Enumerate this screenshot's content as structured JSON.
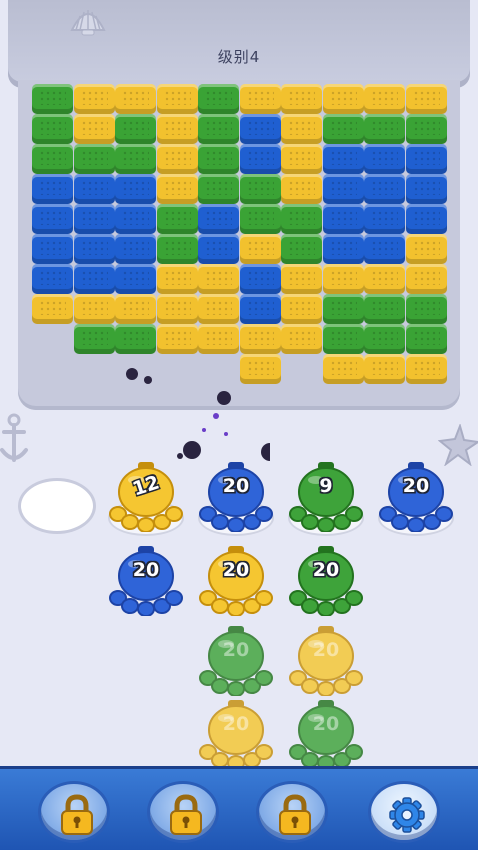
{
  "level": {
    "label": "级别4"
  },
  "colors": {
    "green": "#3aa335",
    "blue": "#1f5fd1",
    "yellow": "#f2c12e"
  },
  "board": {
    "columns": 10,
    "rows": 10,
    "grid": [
      [
        "g",
        "y",
        "y",
        "y",
        "g",
        "y",
        "y",
        "y",
        "y",
        "y"
      ],
      [
        "g",
        "y",
        "g",
        "y",
        "g",
        "b",
        "y",
        "g",
        "g",
        "g"
      ],
      [
        "g",
        "g",
        "g",
        "y",
        "g",
        "b",
        "y",
        "b",
        "b",
        "b"
      ],
      [
        "b",
        "b",
        "b",
        "y",
        "g",
        "g",
        "y",
        "b",
        "b",
        "b"
      ],
      [
        "b",
        "b",
        "b",
        "g",
        "b",
        "g",
        "g",
        "b",
        "b",
        "b"
      ],
      [
        "b",
        "b",
        "b",
        "g",
        "b",
        "y",
        "g",
        "b",
        "b",
        "y"
      ],
      [
        "b",
        "b",
        "b",
        "y",
        "y",
        "b",
        "y",
        "y",
        "y",
        "y"
      ],
      [
        "y",
        "y",
        "y",
        "y",
        "y",
        "b",
        "y",
        "g",
        "g",
        "g"
      ],
      [
        "",
        "g",
        "g",
        "y",
        "y",
        "y",
        "y",
        "g",
        "g",
        "g"
      ],
      [
        "",
        "",
        "",
        "",
        "",
        "y",
        "",
        "y",
        "y",
        "y"
      ]
    ]
  },
  "slots": {
    "empty_count": 1
  },
  "queue": [
    {
      "id": "o1",
      "color": "yellow",
      "count": "12",
      "active": true,
      "dim": false
    },
    {
      "id": "o2",
      "color": "blue",
      "count": "20",
      "active": true,
      "dim": false
    },
    {
      "id": "o3",
      "color": "green",
      "count": "9",
      "active": true,
      "dim": false
    },
    {
      "id": "o4",
      "color": "blue",
      "count": "20",
      "active": true,
      "dim": false
    },
    {
      "id": "o5",
      "color": "blue",
      "count": "20",
      "active": false,
      "dim": false
    },
    {
      "id": "o6",
      "color": "yellow",
      "count": "20",
      "active": false,
      "dim": false
    },
    {
      "id": "o7",
      "color": "green",
      "count": "20",
      "active": false,
      "dim": false
    },
    {
      "id": "o8",
      "color": "green",
      "count": "20",
      "active": false,
      "dim": true
    },
    {
      "id": "o9",
      "color": "yellow",
      "count": "20",
      "active": false,
      "dim": true
    },
    {
      "id": "o10",
      "color": "yellow",
      "count": "20",
      "active": false,
      "dim": true
    },
    {
      "id": "o11",
      "color": "green",
      "count": "20",
      "active": false,
      "dim": true
    }
  ],
  "toolbar": {
    "buttons": [
      {
        "name": "locked-booster-1-button",
        "icon": "lock-icon"
      },
      {
        "name": "locked-booster-2-button",
        "icon": "lock-icon"
      },
      {
        "name": "locked-booster-3-button",
        "icon": "lock-icon"
      },
      {
        "name": "settings-button",
        "icon": "gear-icon"
      }
    ]
  }
}
